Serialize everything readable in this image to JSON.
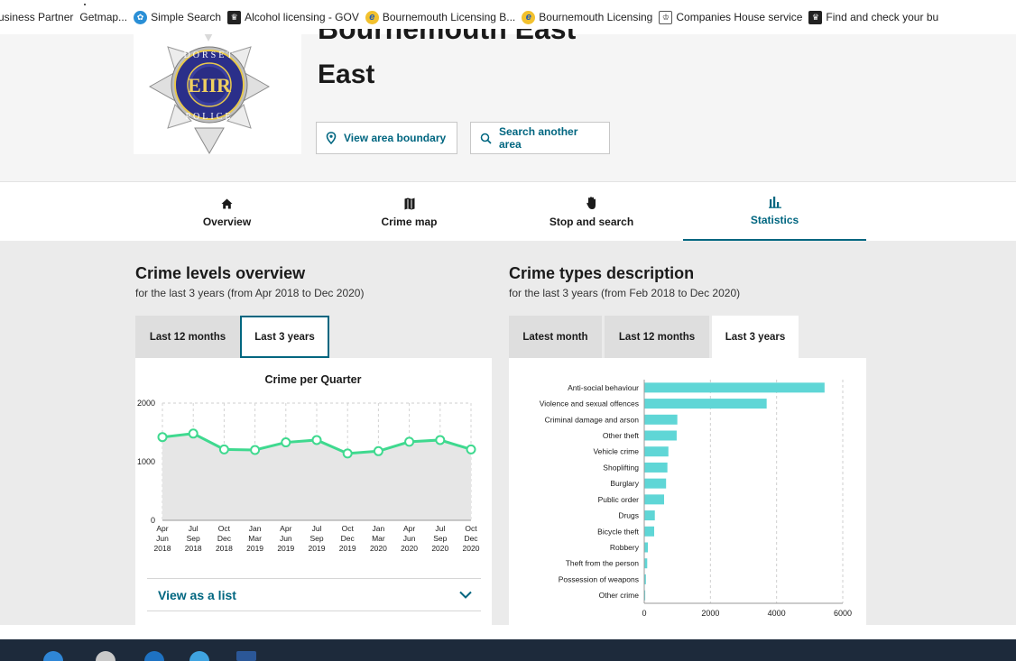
{
  "bookmarks": [
    {
      "label": "usiness Partner",
      "icon": "none"
    },
    {
      "label": "Getmap...",
      "icon": "none"
    },
    {
      "label": "Simple Search",
      "icon": "globe-icon"
    },
    {
      "label": "Alcohol licensing - GOV",
      "icon": "gov-icon"
    },
    {
      "label": "Bournemouth Licensing B...",
      "icon": "ie-icon"
    },
    {
      "label": "Bournemouth Licensing",
      "icon": "ie-icon"
    },
    {
      "label": "Companies House service",
      "icon": "crest-icon"
    },
    {
      "label": "Find and check your bu",
      "icon": "gov-icon"
    }
  ],
  "header": {
    "title_cut": "Bournemouth East",
    "title": "East",
    "view_boundary_label": "View area boundary",
    "search_area_label": "Search another area",
    "logo": {
      "top": "DORSET",
      "bottom": "POLICE",
      "cipher": "EIIR"
    }
  },
  "nav": {
    "tabs": [
      {
        "label": "Overview",
        "icon": "home-icon"
      },
      {
        "label": "Crime map",
        "icon": "map-icon"
      },
      {
        "label": "Stop and search",
        "icon": "hand-icon"
      },
      {
        "label": "Statistics",
        "icon": "bar-chart-icon"
      }
    ],
    "active": "Statistics"
  },
  "levels": {
    "title": "Crime levels overview",
    "subtitle": "for the last 3 years (from Apr 2018 to Dec 2020)",
    "tabs": [
      "Last 12 months",
      "Last 3 years"
    ],
    "selected": "Last 3 years",
    "view_list_label": "View as a list"
  },
  "types": {
    "title": "Crime types description",
    "subtitle": "for the last 3 years (from Feb 2018 to Dec 2020)",
    "tabs": [
      "Latest month",
      "Last 12 months",
      "Last 3 years"
    ],
    "selected": "Last 3 years"
  },
  "colors": {
    "accent": "#006680",
    "line": "#3fd98f",
    "bar": "#5fd6d6",
    "area": "#e6e6e6"
  },
  "chart_data": [
    {
      "type": "area",
      "title": "Crime per Quarter",
      "categories": [
        [
          "Apr",
          "Jun",
          "2018"
        ],
        [
          "Jul",
          "Sep",
          "2018"
        ],
        [
          "Oct",
          "Dec",
          "2018"
        ],
        [
          "Jan",
          "Mar",
          "2019"
        ],
        [
          "Apr",
          "Jun",
          "2019"
        ],
        [
          "Jul",
          "Sep",
          "2019"
        ],
        [
          "Oct",
          "Dec",
          "2019"
        ],
        [
          "Jan",
          "Mar",
          "2020"
        ],
        [
          "Apr",
          "Jun",
          "2020"
        ],
        [
          "Jul",
          "Sep",
          "2020"
        ],
        [
          "Oct",
          "Dec",
          "2020"
        ]
      ],
      "values": [
        1420,
        1480,
        1210,
        1200,
        1330,
        1370,
        1140,
        1180,
        1340,
        1370,
        1210
      ],
      "ylim": [
        0,
        2000
      ],
      "yticks": [
        0,
        1000,
        2000
      ],
      "grid": true
    },
    {
      "type": "bar",
      "orientation": "horizontal",
      "categories": [
        "Anti-social behaviour",
        "Violence and sexual offences",
        "Criminal damage and arson",
        "Other theft",
        "Vehicle crime",
        "Shoplifting",
        "Burglary",
        "Public order",
        "Drugs",
        "Bicycle theft",
        "Robbery",
        "Theft from the person",
        "Possession of weapons",
        "Other crime"
      ],
      "values": [
        5450,
        3700,
        1000,
        980,
        730,
        700,
        660,
        600,
        320,
        300,
        110,
        90,
        50,
        30
      ],
      "xlim": [
        0,
        6000
      ],
      "xticks": [
        0,
        2000,
        4000,
        6000
      ],
      "grid": true
    }
  ]
}
